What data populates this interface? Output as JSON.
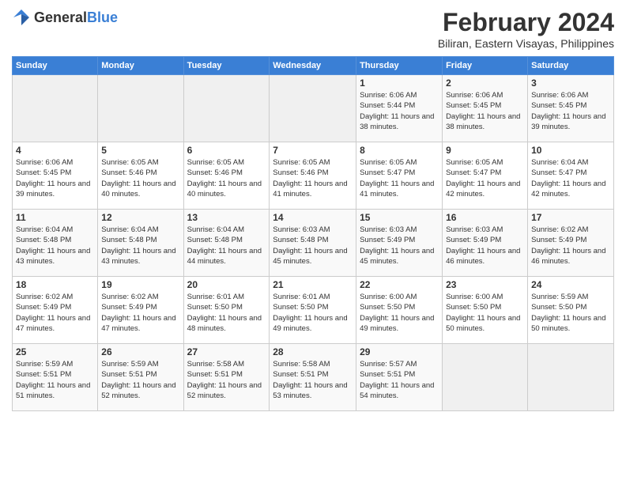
{
  "logo": {
    "text_general": "General",
    "text_blue": "Blue"
  },
  "header": {
    "month_year": "February 2024",
    "location": "Biliran, Eastern Visayas, Philippines"
  },
  "days_of_week": [
    "Sunday",
    "Monday",
    "Tuesday",
    "Wednesday",
    "Thursday",
    "Friday",
    "Saturday"
  ],
  "weeks": [
    [
      {
        "day": "",
        "sunrise": "",
        "sunset": "",
        "daylight": "",
        "empty": true
      },
      {
        "day": "",
        "sunrise": "",
        "sunset": "",
        "daylight": "",
        "empty": true
      },
      {
        "day": "",
        "sunrise": "",
        "sunset": "",
        "daylight": "",
        "empty": true
      },
      {
        "day": "",
        "sunrise": "",
        "sunset": "",
        "daylight": "",
        "empty": true
      },
      {
        "day": "1",
        "sunrise": "Sunrise: 6:06 AM",
        "sunset": "Sunset: 5:44 PM",
        "daylight": "Daylight: 11 hours and 38 minutes."
      },
      {
        "day": "2",
        "sunrise": "Sunrise: 6:06 AM",
        "sunset": "Sunset: 5:45 PM",
        "daylight": "Daylight: 11 hours and 38 minutes."
      },
      {
        "day": "3",
        "sunrise": "Sunrise: 6:06 AM",
        "sunset": "Sunset: 5:45 PM",
        "daylight": "Daylight: 11 hours and 39 minutes."
      }
    ],
    [
      {
        "day": "4",
        "sunrise": "Sunrise: 6:06 AM",
        "sunset": "Sunset: 5:45 PM",
        "daylight": "Daylight: 11 hours and 39 minutes."
      },
      {
        "day": "5",
        "sunrise": "Sunrise: 6:05 AM",
        "sunset": "Sunset: 5:46 PM",
        "daylight": "Daylight: 11 hours and 40 minutes."
      },
      {
        "day": "6",
        "sunrise": "Sunrise: 6:05 AM",
        "sunset": "Sunset: 5:46 PM",
        "daylight": "Daylight: 11 hours and 40 minutes."
      },
      {
        "day": "7",
        "sunrise": "Sunrise: 6:05 AM",
        "sunset": "Sunset: 5:46 PM",
        "daylight": "Daylight: 11 hours and 41 minutes."
      },
      {
        "day": "8",
        "sunrise": "Sunrise: 6:05 AM",
        "sunset": "Sunset: 5:47 PM",
        "daylight": "Daylight: 11 hours and 41 minutes."
      },
      {
        "day": "9",
        "sunrise": "Sunrise: 6:05 AM",
        "sunset": "Sunset: 5:47 PM",
        "daylight": "Daylight: 11 hours and 42 minutes."
      },
      {
        "day": "10",
        "sunrise": "Sunrise: 6:04 AM",
        "sunset": "Sunset: 5:47 PM",
        "daylight": "Daylight: 11 hours and 42 minutes."
      }
    ],
    [
      {
        "day": "11",
        "sunrise": "Sunrise: 6:04 AM",
        "sunset": "Sunset: 5:48 PM",
        "daylight": "Daylight: 11 hours and 43 minutes."
      },
      {
        "day": "12",
        "sunrise": "Sunrise: 6:04 AM",
        "sunset": "Sunset: 5:48 PM",
        "daylight": "Daylight: 11 hours and 43 minutes."
      },
      {
        "day": "13",
        "sunrise": "Sunrise: 6:04 AM",
        "sunset": "Sunset: 5:48 PM",
        "daylight": "Daylight: 11 hours and 44 minutes."
      },
      {
        "day": "14",
        "sunrise": "Sunrise: 6:03 AM",
        "sunset": "Sunset: 5:48 PM",
        "daylight": "Daylight: 11 hours and 45 minutes."
      },
      {
        "day": "15",
        "sunrise": "Sunrise: 6:03 AM",
        "sunset": "Sunset: 5:49 PM",
        "daylight": "Daylight: 11 hours and 45 minutes."
      },
      {
        "day": "16",
        "sunrise": "Sunrise: 6:03 AM",
        "sunset": "Sunset: 5:49 PM",
        "daylight": "Daylight: 11 hours and 46 minutes."
      },
      {
        "day": "17",
        "sunrise": "Sunrise: 6:02 AM",
        "sunset": "Sunset: 5:49 PM",
        "daylight": "Daylight: 11 hours and 46 minutes."
      }
    ],
    [
      {
        "day": "18",
        "sunrise": "Sunrise: 6:02 AM",
        "sunset": "Sunset: 5:49 PM",
        "daylight": "Daylight: 11 hours and 47 minutes."
      },
      {
        "day": "19",
        "sunrise": "Sunrise: 6:02 AM",
        "sunset": "Sunset: 5:49 PM",
        "daylight": "Daylight: 11 hours and 47 minutes."
      },
      {
        "day": "20",
        "sunrise": "Sunrise: 6:01 AM",
        "sunset": "Sunset: 5:50 PM",
        "daylight": "Daylight: 11 hours and 48 minutes."
      },
      {
        "day": "21",
        "sunrise": "Sunrise: 6:01 AM",
        "sunset": "Sunset: 5:50 PM",
        "daylight": "Daylight: 11 hours and 49 minutes."
      },
      {
        "day": "22",
        "sunrise": "Sunrise: 6:00 AM",
        "sunset": "Sunset: 5:50 PM",
        "daylight": "Daylight: 11 hours and 49 minutes."
      },
      {
        "day": "23",
        "sunrise": "Sunrise: 6:00 AM",
        "sunset": "Sunset: 5:50 PM",
        "daylight": "Daylight: 11 hours and 50 minutes."
      },
      {
        "day": "24",
        "sunrise": "Sunrise: 5:59 AM",
        "sunset": "Sunset: 5:50 PM",
        "daylight": "Daylight: 11 hours and 50 minutes."
      }
    ],
    [
      {
        "day": "25",
        "sunrise": "Sunrise: 5:59 AM",
        "sunset": "Sunset: 5:51 PM",
        "daylight": "Daylight: 11 hours and 51 minutes."
      },
      {
        "day": "26",
        "sunrise": "Sunrise: 5:59 AM",
        "sunset": "Sunset: 5:51 PM",
        "daylight": "Daylight: 11 hours and 52 minutes."
      },
      {
        "day": "27",
        "sunrise": "Sunrise: 5:58 AM",
        "sunset": "Sunset: 5:51 PM",
        "daylight": "Daylight: 11 hours and 52 minutes."
      },
      {
        "day": "28",
        "sunrise": "Sunrise: 5:58 AM",
        "sunset": "Sunset: 5:51 PM",
        "daylight": "Daylight: 11 hours and 53 minutes."
      },
      {
        "day": "29",
        "sunrise": "Sunrise: 5:57 AM",
        "sunset": "Sunset: 5:51 PM",
        "daylight": "Daylight: 11 hours and 54 minutes."
      },
      {
        "day": "",
        "sunrise": "",
        "sunset": "",
        "daylight": "",
        "empty": true
      },
      {
        "day": "",
        "sunrise": "",
        "sunset": "",
        "daylight": "",
        "empty": true
      }
    ]
  ]
}
